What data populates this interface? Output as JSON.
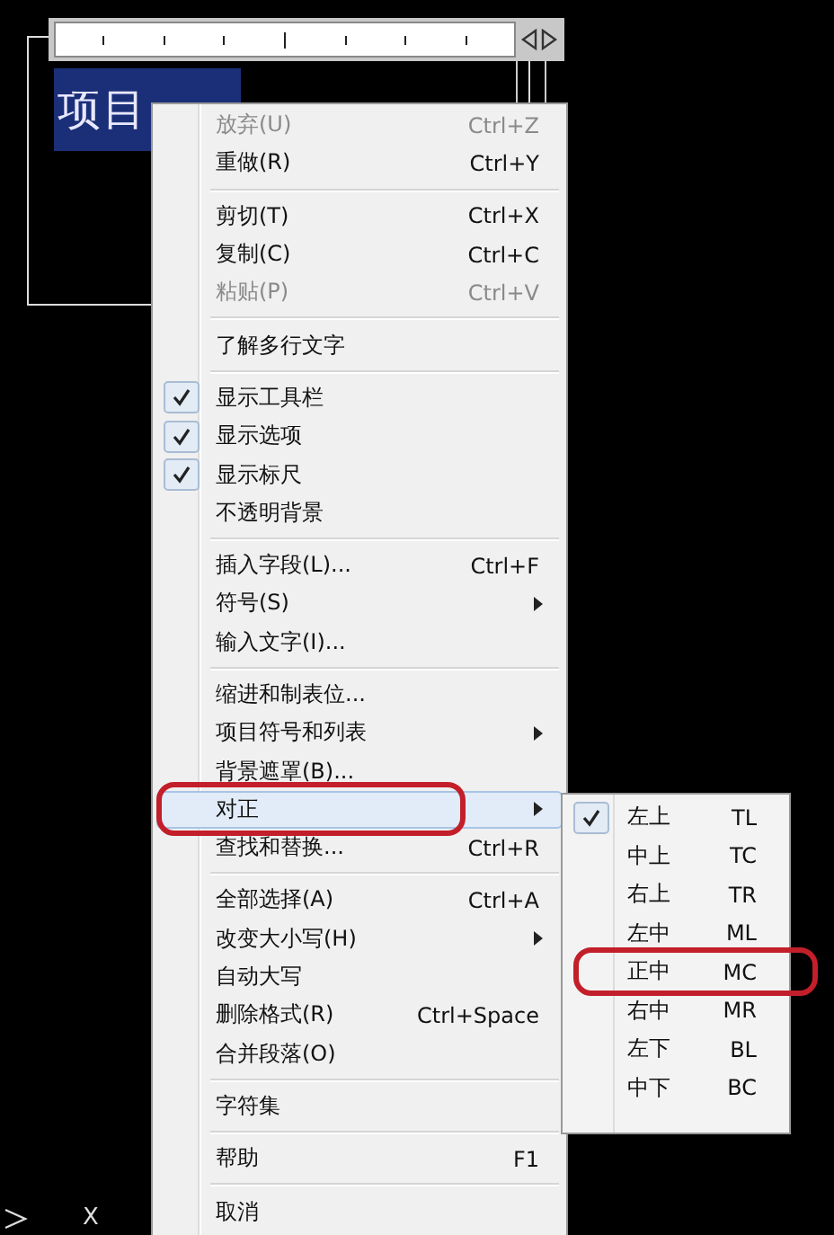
{
  "editor": {
    "text": "项目"
  },
  "context_menu": {
    "items": [
      {
        "kind": "item",
        "label": "放弃(U)",
        "shortcut": "Ctrl+Z",
        "disabled": true
      },
      {
        "kind": "item",
        "label": "重做(R)",
        "shortcut": "Ctrl+Y",
        "disabled": false
      },
      {
        "kind": "separator"
      },
      {
        "kind": "item",
        "label": "剪切(T)",
        "shortcut": "Ctrl+X",
        "disabled": false
      },
      {
        "kind": "item",
        "label": "复制(C)",
        "shortcut": "Ctrl+C",
        "disabled": false
      },
      {
        "kind": "item",
        "label": "粘贴(P)",
        "shortcut": "Ctrl+V",
        "disabled": true
      },
      {
        "kind": "separator"
      },
      {
        "kind": "item",
        "label": "了解多行文字",
        "disabled": false
      },
      {
        "kind": "separator"
      },
      {
        "kind": "item",
        "label": "显示工具栏",
        "checked": true,
        "disabled": false
      },
      {
        "kind": "item",
        "label": "显示选项",
        "checked": true,
        "disabled": false
      },
      {
        "kind": "item",
        "label": "显示标尺",
        "checked": true,
        "disabled": false
      },
      {
        "kind": "item",
        "label": "不透明背景",
        "checked": false,
        "disabled": false
      },
      {
        "kind": "separator"
      },
      {
        "kind": "item",
        "label": "插入字段(L)...",
        "shortcut": "Ctrl+F",
        "disabled": false
      },
      {
        "kind": "item",
        "label": "符号(S)",
        "submenu": true,
        "disabled": false
      },
      {
        "kind": "item",
        "label": "输入文字(I)...",
        "disabled": false
      },
      {
        "kind": "separator"
      },
      {
        "kind": "item",
        "label": "缩进和制表位...",
        "disabled": false
      },
      {
        "kind": "item",
        "label": "项目符号和列表",
        "submenu": true,
        "disabled": false
      },
      {
        "kind": "item",
        "label": "背景遮罩(B)...",
        "disabled": false
      },
      {
        "kind": "item",
        "label": "对正",
        "submenu": true,
        "selected": true,
        "circled": true,
        "disabled": false
      },
      {
        "kind": "item",
        "label": "查找和替换...",
        "shortcut": "Ctrl+R",
        "disabled": false
      },
      {
        "kind": "separator"
      },
      {
        "kind": "item",
        "label": "全部选择(A)",
        "shortcut": "Ctrl+A",
        "disabled": false
      },
      {
        "kind": "item",
        "label": "改变大小写(H)",
        "submenu": true,
        "disabled": false
      },
      {
        "kind": "item",
        "label": "自动大写",
        "disabled": false
      },
      {
        "kind": "item",
        "label": "删除格式(R)",
        "shortcut": "Ctrl+Space",
        "disabled": false
      },
      {
        "kind": "item",
        "label": "合并段落(O)",
        "disabled": false
      },
      {
        "kind": "separator"
      },
      {
        "kind": "item",
        "label": "字符集",
        "disabled": false
      },
      {
        "kind": "separator"
      },
      {
        "kind": "item",
        "label": "帮助",
        "shortcut": "F1",
        "disabled": false
      },
      {
        "kind": "separator"
      },
      {
        "kind": "item",
        "label": "取消",
        "disabled": false
      }
    ]
  },
  "justify_submenu": {
    "items": [
      {
        "label": "左上",
        "code": "TL",
        "checked": true,
        "circled": false
      },
      {
        "label": "中上",
        "code": "TC",
        "checked": false,
        "circled": false
      },
      {
        "label": "右上",
        "code": "TR",
        "checked": false,
        "circled": false
      },
      {
        "label": "左中",
        "code": "ML",
        "checked": false,
        "circled": false
      },
      {
        "label": "正中",
        "code": "MC",
        "checked": false,
        "circled": true
      },
      {
        "label": "右中",
        "code": "MR",
        "checked": false,
        "circled": false
      },
      {
        "label": "左下",
        "code": "BL",
        "checked": false,
        "circled": false
      },
      {
        "label": "中下",
        "code": "BC",
        "checked": false,
        "circled": false
      }
    ]
  },
  "ucs_icon": {
    "axis_label": "X"
  }
}
